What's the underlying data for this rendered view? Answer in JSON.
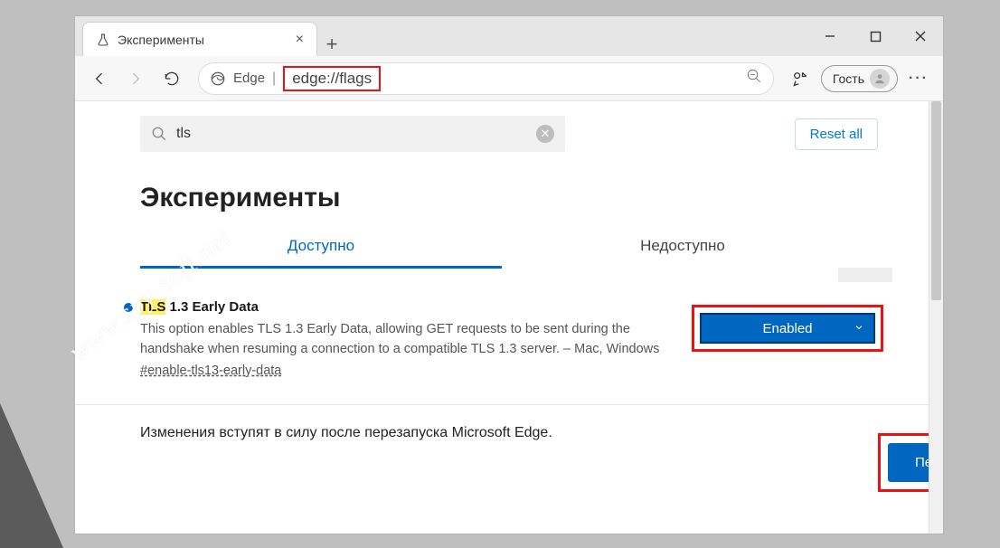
{
  "window": {
    "tab_title": "Эксперименты",
    "address_label": "Edge",
    "url": "edge://flags",
    "profile_label": "Гость"
  },
  "page": {
    "search_value": "tls",
    "reset_label": "Reset all",
    "heading": "Эксперименты",
    "tabs": {
      "available": "Доступно",
      "unavailable": "Недоступно"
    }
  },
  "flag": {
    "title_hl": "TLS",
    "title_rest": " 1.3 Early Data",
    "description": "This option enables TLS 1.3 Early Data, allowing GET requests to be sent during the handshake when resuming a connection to a compatible TLS 1.3 server. – Mac, Windows",
    "tag": "#enable-tls13-early-data",
    "select_value": "Enabled"
  },
  "footer": {
    "message": "Изменения вступят в силу после перезапуска Microsoft Edge.",
    "restart_label": "Перезапуск"
  },
  "colors": {
    "accent": "#0067c0",
    "highlight_box": "#e11"
  },
  "watermark": "www.spy-soft.net"
}
